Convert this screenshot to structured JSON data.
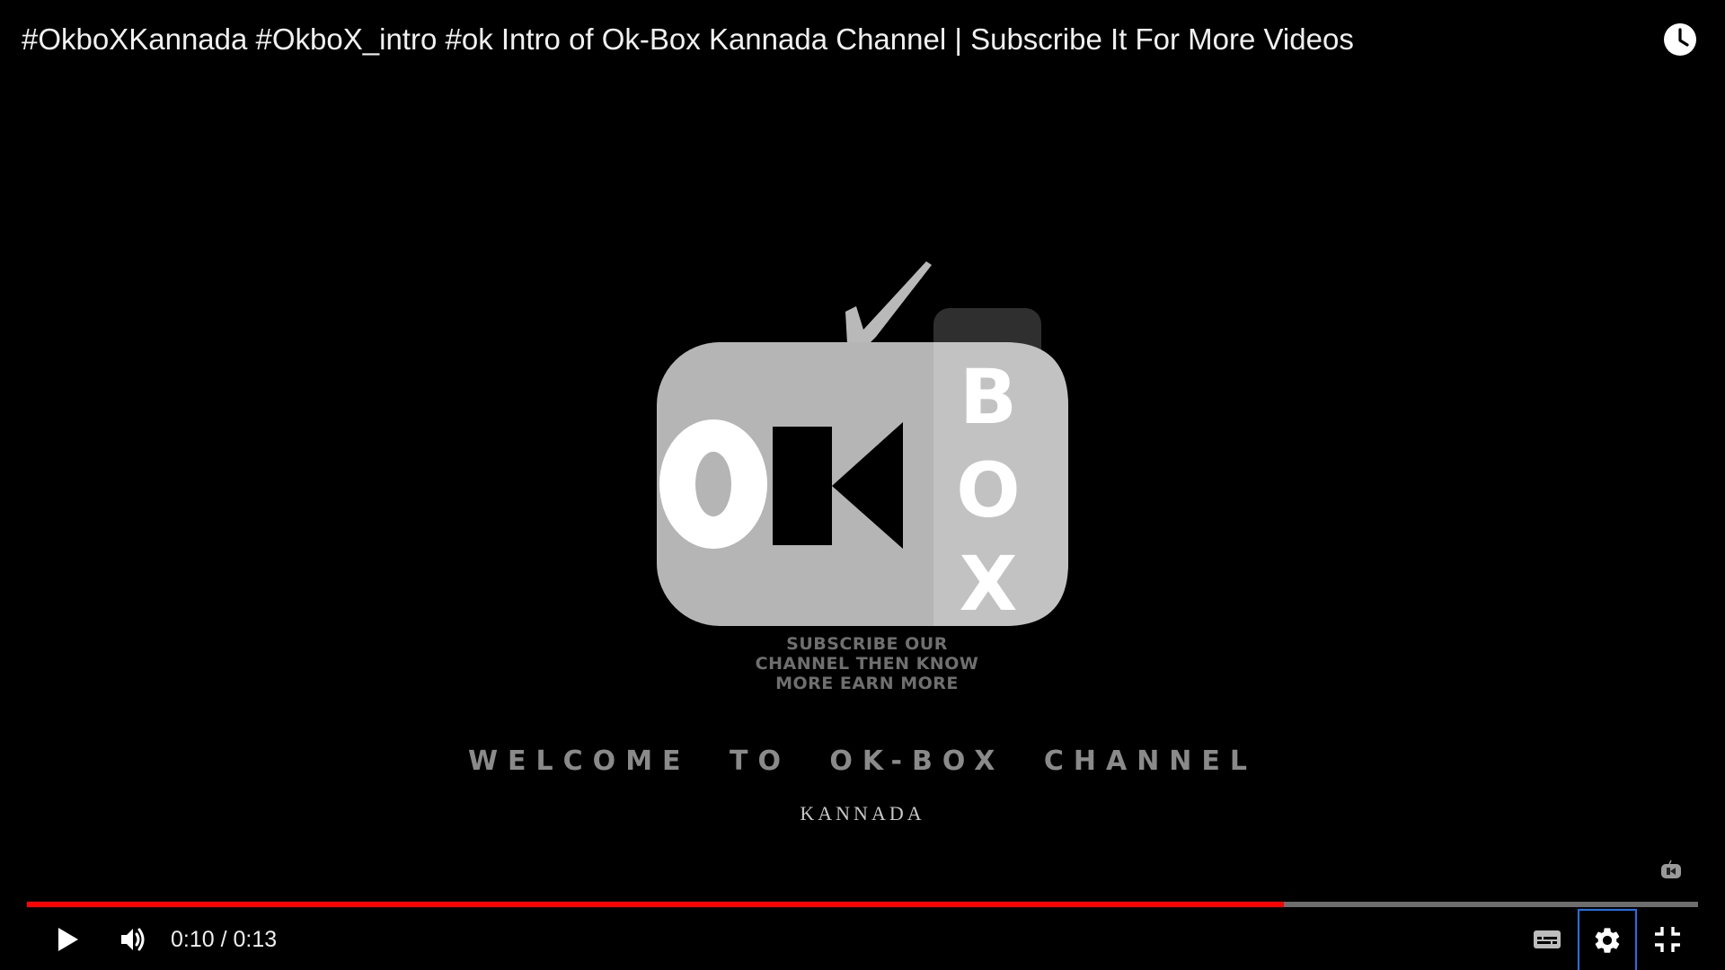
{
  "header": {
    "title": "#OkboXKannada #OkboX_intro #ok Intro of Ok-Box Kannada Channel | Subscribe It For More Videos",
    "watch_later_icon": "clock-icon"
  },
  "video": {
    "logo": {
      "ok_text": "OK",
      "box_letters": [
        "B",
        "O",
        "X"
      ]
    },
    "tagline": [
      "SUBSCRIBE OUR",
      "CHANNEL THEN KNOW",
      "MORE EARN MORE"
    ],
    "welcome_text": "WELCOME TO OK-BOX CHANNEL",
    "subtitle_text": "KANNADA"
  },
  "controls": {
    "progress_fraction": 0.752,
    "current_time": "0:10",
    "duration": "0:13",
    "time_display": "0:10 / 0:13",
    "colors": {
      "played": "#ff0000",
      "track": "#6e6e6e",
      "focus": "#1a73e8"
    },
    "icons": {
      "play": "play-icon",
      "volume": "volume-icon",
      "captions": "captions-icon",
      "settings": "gear-icon",
      "fullscreen": "exit-fullscreen-icon"
    }
  }
}
